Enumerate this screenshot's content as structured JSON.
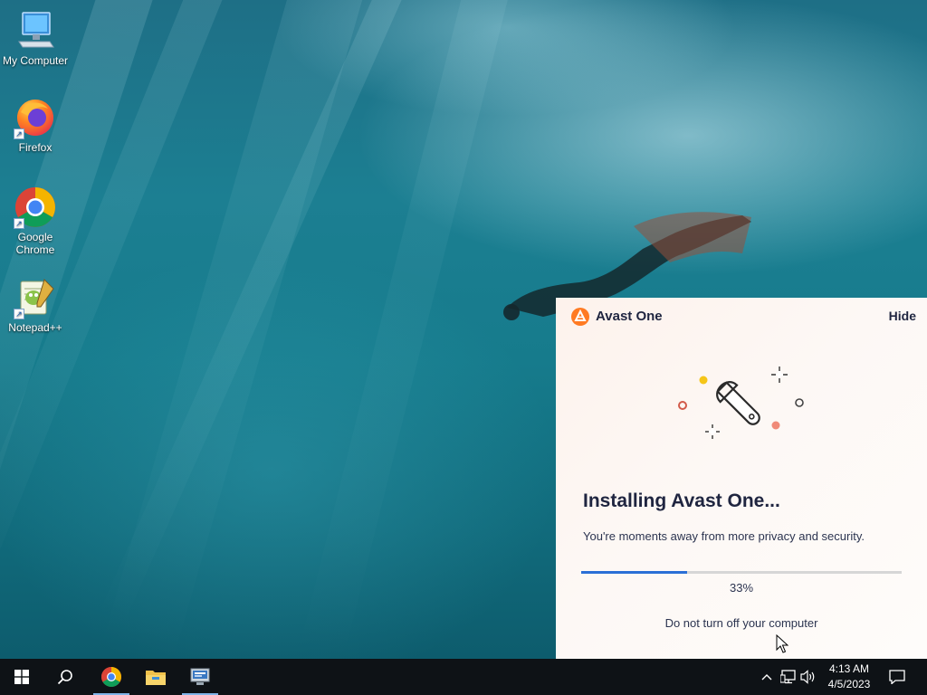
{
  "desktop": {
    "icons": [
      {
        "label": "My Computer",
        "icon": "computer-icon"
      },
      {
        "label": "Firefox",
        "icon": "firefox-icon"
      },
      {
        "label": "Google Chrome",
        "icon": "chrome-icon"
      },
      {
        "label": "Notepad++",
        "icon": "notepadpp-icon"
      }
    ]
  },
  "avast": {
    "app_name": "Avast One",
    "hide_label": "Hide",
    "heading": "Installing Avast One...",
    "subtitle": "You're moments away from more privacy and security.",
    "progress_fraction": 0.33,
    "progress_text": "33%",
    "warning": "Do not turn off your computer",
    "accent_color": "#2b6fd6",
    "brand_color": "#ff7a22",
    "illustration_icon": "wrench-icon"
  },
  "taskbar": {
    "start_icon": "windows-start-icon",
    "search_icon": "search-icon",
    "pinned": [
      {
        "name": "Google Chrome",
        "icon": "chrome-icon",
        "active": true
      },
      {
        "name": "File Explorer",
        "icon": "folder-icon",
        "active": false
      },
      {
        "name": "Installer",
        "icon": "installer-icon",
        "active": true
      }
    ],
    "tray": {
      "icons": [
        "chevron-up-icon",
        "network-icon",
        "volume-icon"
      ],
      "time": "4:13 AM",
      "date": "4/5/2023",
      "notification_icon": "notification-icon"
    }
  }
}
